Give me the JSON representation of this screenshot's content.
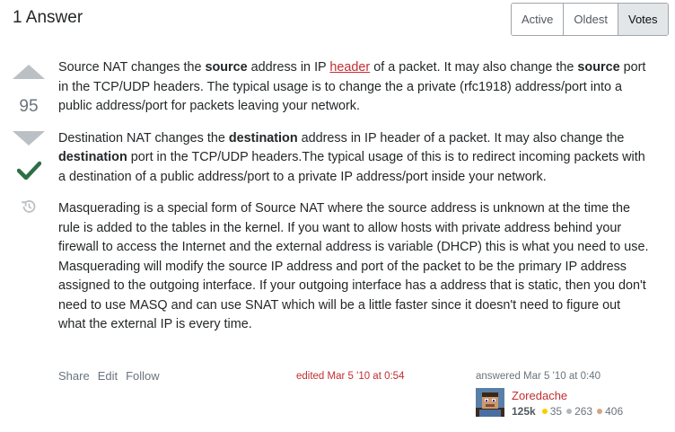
{
  "header": {
    "title": "1 Answer",
    "tabs": [
      {
        "label": "Active"
      },
      {
        "label": "Oldest"
      },
      {
        "label": "Votes"
      }
    ]
  },
  "vote": {
    "count": "95"
  },
  "post": {
    "p1": {
      "a": "Source NAT changes the ",
      "b": "source",
      "c": " address in IP ",
      "link": "header",
      "d": " of a packet. It may also change the ",
      "e": "source",
      "f": " port in the TCP/UDP headers. The typical usage is to change the a private (rfc1918) address/port into a public address/port for packets leaving your network."
    },
    "p2": {
      "a": "Destination NAT changes the ",
      "b": "destination",
      "c": " address in IP header of a packet. It may also change the ",
      "d": "destination",
      "e": " port in the TCP/UDP headers.The typical usage of this is to redirect incoming packets with a destination of a public address/port to a private IP address/port inside your network."
    },
    "p3": "Masquerading is a special form of Source NAT where the source address is unknown at the time the rule is added to the tables in the kernel. If you want to allow hosts with private address behind your firewall to access the Internet and the external address is variable (DHCP) this is what you need to use. Masquerading will modify the source IP address and port of the packet to be the primary IP address assigned to the outgoing interface. If your outgoing interface has a address that is static, then you don't need to use MASQ and can use SNAT which will be a little faster since it doesn't need to figure out what the external IP is every time."
  },
  "menu": {
    "share": "Share",
    "edit": "Edit",
    "follow": "Follow"
  },
  "edited": "edited Mar 5 '10 at 0:54",
  "answered": "answered Mar 5 '10 at 0:40",
  "user": {
    "name": "Zoredache",
    "reputation": "125k",
    "gold": "35",
    "silver": "263",
    "bronze": "406"
  },
  "colors": {
    "accent": "#c22e32",
    "accepted": "#2f6f44",
    "vote_arrow": "#bbc0c4"
  }
}
